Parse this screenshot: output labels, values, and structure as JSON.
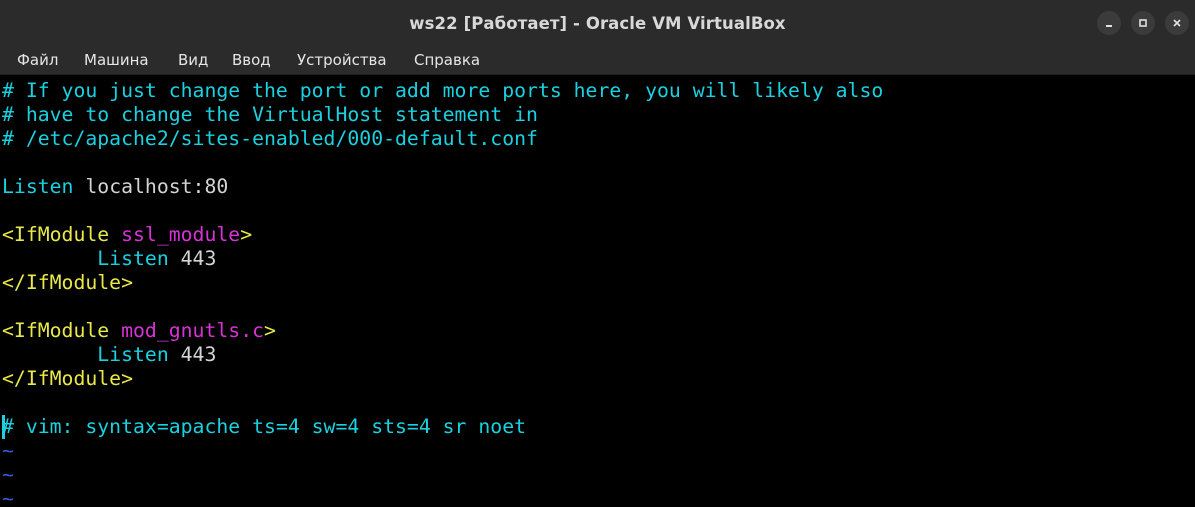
{
  "window": {
    "title": "ws22 [Работает] - Oracle VM VirtualBox",
    "controls": {
      "minimize_icon": "minimize-icon",
      "maximize_icon": "maximize-icon",
      "close_icon": "close-icon"
    }
  },
  "menu": {
    "items": [
      "Файл",
      "Машина",
      "Вид",
      "Ввод",
      "Устройства",
      "Справка"
    ]
  },
  "terminal": {
    "lines": {
      "comment1": "# If you just change the port or add more ports here, you will likely also",
      "comment2": "# have to change the VirtualHost statement in",
      "comment3": "# /etc/apache2/sites-enabled/000-default.conf",
      "listen_keyword": "Listen",
      "listen_value": " localhost:80",
      "ifmodule1_open": "<IfModule",
      "ifmodule1_module": " ssl_module",
      "ifmodule1_close_bracket": ">",
      "ifmodule1_listen_keyword": "        Listen",
      "ifmodule1_listen_value": " 443",
      "ifmodule1_end": "</IfModule>",
      "ifmodule2_open": "<IfModule",
      "ifmodule2_module": " mod_gnutls.c",
      "ifmodule2_close_bracket": ">",
      "ifmodule2_listen_keyword": "        Listen",
      "ifmodule2_listen_value": " 443",
      "ifmodule2_end": "</IfModule>",
      "modeline": "# vim: syntax=apache ts=4 sw=4 sts=4 sr noet",
      "tilde": "~"
    },
    "colors": {
      "comment": "#1ad1e0",
      "text": "#d4d4d4",
      "tag": "#e8e84a",
      "module": "#d633d6",
      "tilde": "#3b5bd6"
    }
  }
}
